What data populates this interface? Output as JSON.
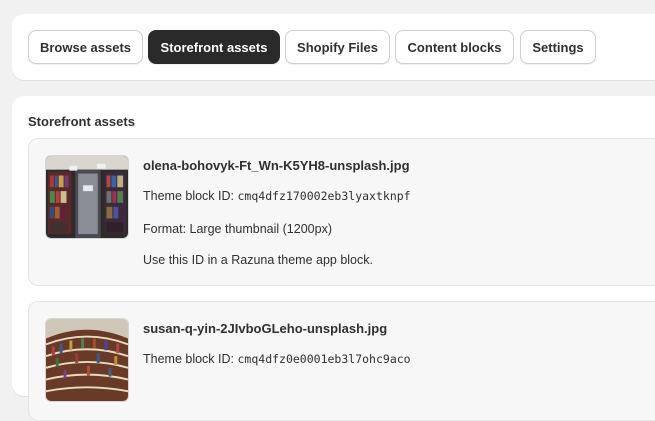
{
  "tabs": [
    {
      "label": "Browse assets",
      "active": false
    },
    {
      "label": "Storefront assets",
      "active": true
    },
    {
      "label": "Shopify Files",
      "active": false
    },
    {
      "label": "Content blocks",
      "active": false
    },
    {
      "label": "Settings",
      "active": false
    }
  ],
  "section": {
    "title": "Storefront assets"
  },
  "assets": [
    {
      "name": "olena-bohovyk-Ft_Wn-K5YH8-unsplash.jpg",
      "id_label": "Theme block ID:",
      "id_value": "cmq4dfz170002eb3lyaxtknpf",
      "format": "Format: Large thumbnail (1200px)",
      "hint": "Use this ID in a Razuna theme app block."
    },
    {
      "name": "susan-q-yin-2JIvboGLeho-unsplash.jpg",
      "id_label": "Theme block ID:",
      "id_value": "cmq4dfz0e0001eb3l7ohc9aco"
    }
  ],
  "colors": {
    "page_bg": "#f1f1f1",
    "card_bg": "#ffffff",
    "active_tab_bg": "#2a2a2a",
    "text": "#303030"
  }
}
